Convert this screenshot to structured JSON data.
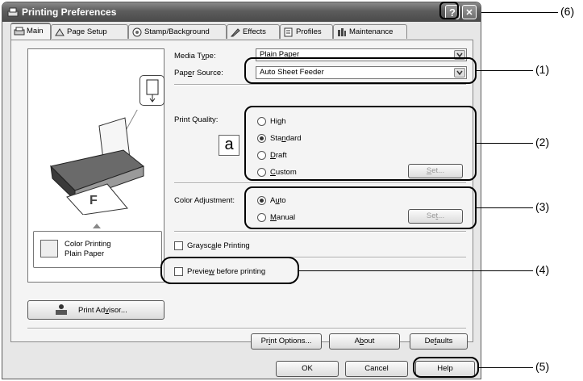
{
  "window": {
    "title": "Printing Preferences",
    "help_button": "?",
    "close_button": "✕"
  },
  "tabs": [
    {
      "label": "Main",
      "icon": "printer-icon",
      "active": true
    },
    {
      "label": "Page Setup",
      "icon": "page-setup-icon"
    },
    {
      "label": "Stamp/Background",
      "icon": "stamp-icon"
    },
    {
      "label": "Effects",
      "icon": "effects-icon"
    },
    {
      "label": "Profiles",
      "icon": "profiles-icon"
    },
    {
      "label": "Maintenance",
      "icon": "maintenance-icon"
    }
  ],
  "main": {
    "media_type": {
      "label_pre": "Media T",
      "label_u": "y",
      "label_post": "pe:",
      "value": "Plain Paper"
    },
    "paper_source": {
      "label_pre": "Pap",
      "label_u": "e",
      "label_post": "r Source:",
      "value": "Auto Sheet Feeder"
    },
    "print_quality": {
      "label": "Print Quality:",
      "options": [
        {
          "pre": "Hi",
          "u": "g",
          "post": "h",
          "selected": false
        },
        {
          "pre": "Sta",
          "u": "n",
          "post": "dard",
          "selected": true
        },
        {
          "pre": "",
          "u": "D",
          "post": "raft",
          "selected": false
        },
        {
          "pre": "",
          "u": "C",
          "post": "ustom",
          "selected": false
        }
      ],
      "set_button": {
        "pre": "",
        "u": "S",
        "post": "et..."
      }
    },
    "color_adjustment": {
      "label": "Color Adjustment:",
      "options": [
        {
          "pre": "A",
          "u": "u",
          "post": "to",
          "selected": true
        },
        {
          "pre": "",
          "u": "M",
          "post": "anual",
          "selected": false
        }
      ],
      "set_button": {
        "pre": "Se",
        "u": "t",
        "post": "..."
      }
    },
    "grayscale": {
      "pre": "Graysc",
      "u": "a",
      "post": "le Printing",
      "checked": false
    },
    "preview": {
      "pre": "Previe",
      "u": "w",
      "post": " before printing",
      "checked": false
    },
    "status": {
      "line1": "Color Printing",
      "line2": "Plain Paper"
    },
    "print_advisor": {
      "pre": "Print Ad",
      "u": "v",
      "post": "isor..."
    },
    "print_options": {
      "pre": "Pr",
      "u": "i",
      "post": "nt Options..."
    },
    "about": {
      "pre": "A",
      "u": "b",
      "post": "out"
    },
    "defaults": {
      "pre": "De",
      "u": "f",
      "post": "aults"
    }
  },
  "footer": {
    "ok": "OK",
    "cancel": "Cancel",
    "help": "Help"
  },
  "callouts": [
    "(1)",
    "(2)",
    "(3)",
    "(4)",
    "(5)",
    "(6)"
  ]
}
